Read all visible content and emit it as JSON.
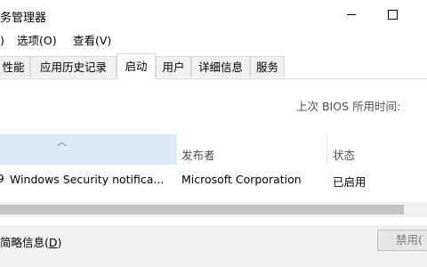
{
  "window": {
    "title": "务管理器",
    "controls": {
      "minimize": "minimize",
      "maximize": "maximize",
      "close": "✕"
    }
  },
  "menu": {
    "items": [
      {
        "label": ")"
      },
      {
        "label": "选项(O)"
      },
      {
        "label": "查看(V)"
      }
    ]
  },
  "tabs": [
    {
      "label": "性能"
    },
    {
      "label": "应用历史记录"
    },
    {
      "label": "启动",
      "active": true
    },
    {
      "label": "用户"
    },
    {
      "label": "详细信息"
    },
    {
      "label": "服务"
    }
  ],
  "startup": {
    "bios_label": "上次 BIOS 所用时间:"
  },
  "table": {
    "columns": [
      {
        "label": ""
      },
      {
        "label": "发布者"
      },
      {
        "label": "状态"
      }
    ],
    "rows": [
      {
        "name": "Windows Security notifica...",
        "publisher": "Microsoft Corporation",
        "status": "已启用"
      }
    ]
  },
  "footer": {
    "fewer_details": "简略信息",
    "fewer_details_key": "D",
    "disable_button": "禁用("
  },
  "colors": {
    "header_highlight": "#d9ebf9",
    "footer_bg": "#f0f0f0"
  },
  "icons": {
    "sort": "chevron-up-icon",
    "app": "shield-icon"
  }
}
